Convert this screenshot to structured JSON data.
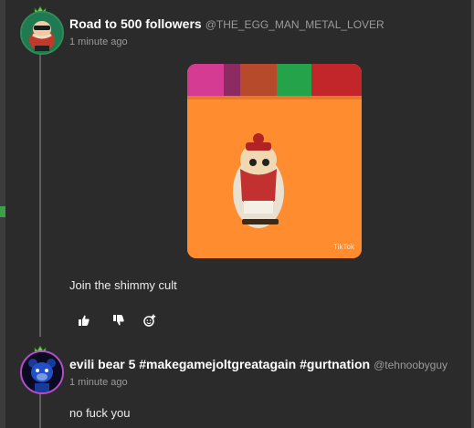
{
  "post": {
    "author": "Road to 500 followers",
    "handle": "@THE_EGG_MAN_METAL_LOVER",
    "time": "1 minute ago",
    "text": "Join the shimmy cult",
    "media_watermark": "TikTok",
    "actions": [
      "thumbs-up-icon",
      "thumbs-down-icon",
      "add-reaction-icon"
    ]
  },
  "reply": {
    "author": "evili bear 5 #makegamejoltgreatagain #gurtnation",
    "handle": "@tehnoobyguy",
    "time": "1 minute ago",
    "text": "no fuck you"
  },
  "colors": {
    "background": "#2b2b2b",
    "avatar1_ring": "#2e8b57",
    "avatar2_ring": "#b64dc8",
    "muted_text": "#9a9a9a"
  }
}
